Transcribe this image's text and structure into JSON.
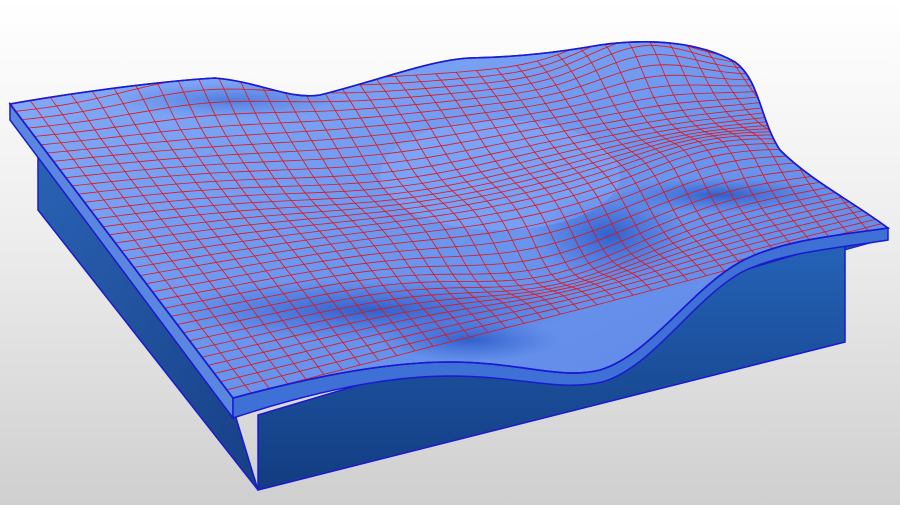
{
  "scene": {
    "background_top": "#ffffff",
    "background_bottom": "#cfcfcf",
    "surface_color": "#6f98ef",
    "surface_highlight": "#a9c6ff",
    "shadow_color": "#2f5fcf",
    "side_color": "#1f56a8",
    "side_dark": "#143f86",
    "edge_color": "#1a1ad0",
    "mesh_color": "#e0151a",
    "mesh_rows": 36,
    "mesh_cols": 36
  }
}
